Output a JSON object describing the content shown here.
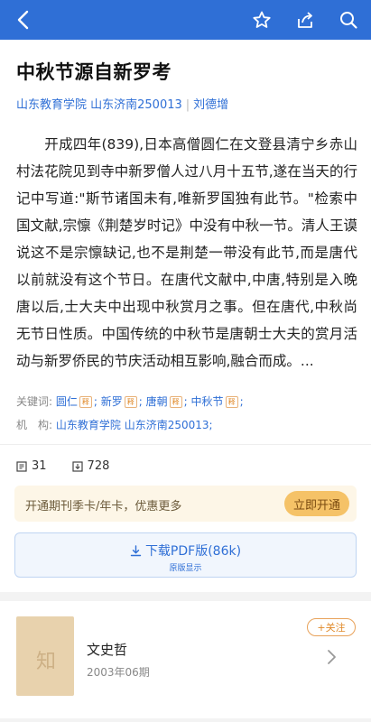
{
  "header": {
    "back_icon": "chevron-left-icon",
    "actions": [
      "star-icon",
      "share-icon",
      "search-icon"
    ],
    "bg_color": "#2f6fd6"
  },
  "article": {
    "title": "中秋节源自新罗考",
    "institution": "山东教育学院 山东济南250013",
    "author": "刘德增",
    "abstract": "开成四年(839),日本高僧圆仁在文登县清宁乡赤山村法花院见到寺中新罗僧人过八月十五节,遂在当天的行记中写道:\"斯节诸国未有,唯新罗国独有此节。\"检索中国文献,宗懔《荆楚岁时记》中没有中秋一节。清人王谟说这不是宗懔缺记,也不是荆楚一带没有此节,而是唐代以前就没有这个节日。在唐代文献中,中唐,特别是入晚唐以后,士大夫中出现中秋赏月之事。但在唐代,中秋尚无节日性质。中国传统的中秋节是唐朝士大夫的赏月活动与新罗侨民的节庆活动相互影响,融合而成。...",
    "keywords_label": "关键词:",
    "keywords": [
      {
        "word": "圆仁",
        "tag": "释"
      },
      {
        "word": "新罗",
        "tag": "释"
      },
      {
        "word": "唐朝",
        "tag": "释"
      },
      {
        "word": "中秋节",
        "tag": "释"
      }
    ],
    "keyword_sep": ";",
    "org_label": "机　构:",
    "org_value": "山东教育学院 山东济南250013;"
  },
  "stats": {
    "citations": "31",
    "downloads": "728"
  },
  "promo": {
    "text": "开通期刊季卡/年卡，优惠更多",
    "button": "立即开通"
  },
  "download": {
    "label": "下载PDF版(86k)",
    "sub": "原版显示"
  },
  "journal": {
    "cover_char": "知",
    "name": "文史哲",
    "issue": "2003年06期",
    "follow": "+关注"
  }
}
